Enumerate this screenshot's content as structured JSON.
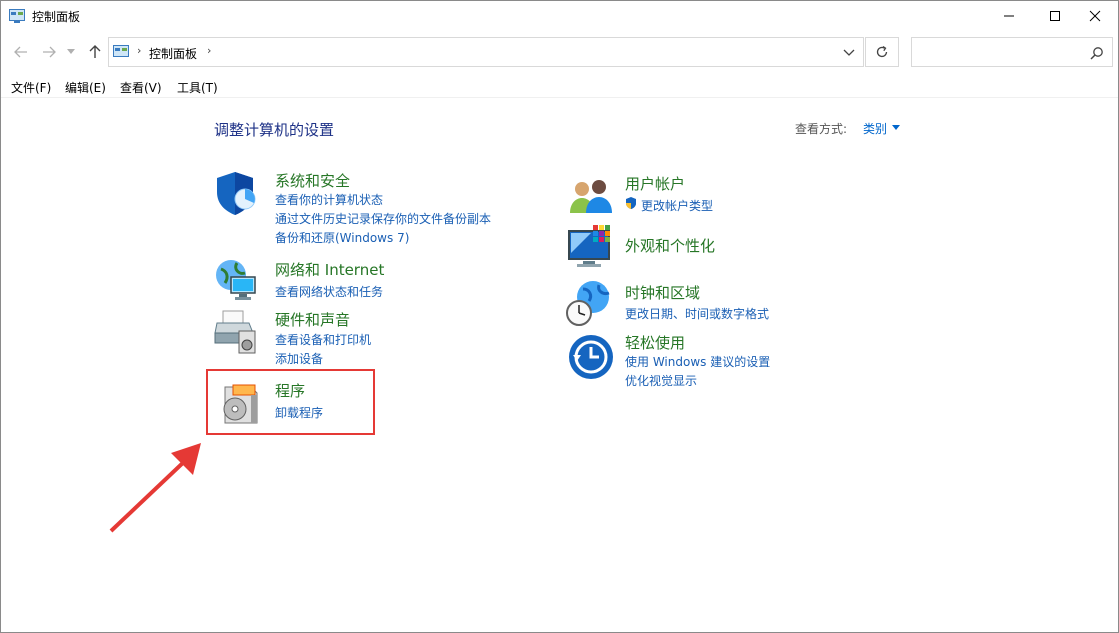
{
  "window": {
    "title": "控制面板"
  },
  "address": {
    "path": "控制面板",
    "search_placeholder": ""
  },
  "menu": [
    "文件(F)",
    "编辑(E)",
    "查看(V)",
    "工具(T)"
  ],
  "content": {
    "heading": "调整计算机的设置",
    "view_by_label": "查看方式:",
    "view_by_value": "类别"
  },
  "categories": {
    "security": {
      "title": "系统和安全",
      "links": [
        "查看你的计算机状态",
        "通过文件历史记录保存你的文件备份副本",
        "备份和还原(Windows 7)"
      ]
    },
    "network": {
      "title": "网络和 Internet",
      "links": [
        "查看网络状态和任务"
      ]
    },
    "hardware": {
      "title": "硬件和声音",
      "links": [
        "查看设备和打印机",
        "添加设备"
      ]
    },
    "programs": {
      "title": "程序",
      "links": [
        "卸载程序"
      ]
    },
    "users": {
      "title": "用户帐户",
      "links": [
        "更改帐户类型"
      ]
    },
    "appearance": {
      "title": "外观和个性化",
      "links": []
    },
    "clock": {
      "title": "时钟和区域",
      "links": [
        "更改日期、时间或数字格式"
      ]
    },
    "ease": {
      "title": "轻松使用",
      "links": [
        "使用 Windows 建议的设置",
        "优化视觉显示"
      ]
    }
  },
  "annotation": {
    "color": "#e53935"
  }
}
